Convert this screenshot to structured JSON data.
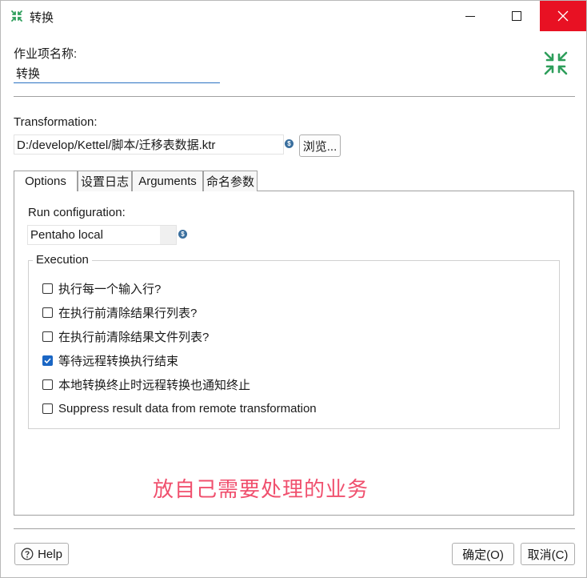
{
  "window": {
    "title": "转换",
    "icon": "transformation-icon",
    "controls": {
      "minimize": "minimize-icon",
      "maximize": "maximize-icon",
      "close": "close-icon"
    }
  },
  "job": {
    "name_label": "作业项名称:",
    "name_value": "转换",
    "badge_icon": "transform-arrows-icon",
    "badge_color": "#2e9e5b"
  },
  "transformation": {
    "label": "Transformation:",
    "path": "D:/develop/Kettel/脚本/迁移表数据.ktr",
    "browse_label": "浏览..."
  },
  "tabs": [
    {
      "label": "Options",
      "active": true
    },
    {
      "label": "设置日志",
      "active": false
    },
    {
      "label": "Arguments",
      "active": false
    },
    {
      "label": "命名参数",
      "active": false
    }
  ],
  "options": {
    "run_config_label": "Run configuration:",
    "run_config_value": "Pentaho local",
    "execution_label": "Execution",
    "checkboxes": [
      {
        "label": "执行每一个输入行?",
        "checked": false
      },
      {
        "label": "在执行前清除结果行列表?",
        "checked": false
      },
      {
        "label": "在执行前清除结果文件列表?",
        "checked": false
      },
      {
        "label": "等待远程转换执行结束",
        "checked": true
      },
      {
        "label": "本地转换终止时远程转换也通知终止",
        "checked": false
      },
      {
        "label": "Suppress result data from remote transformation",
        "checked": false
      }
    ]
  },
  "annotation": {
    "text": "放自己需要处理的业务",
    "color": "#f0506e"
  },
  "footer": {
    "help_label": "Help",
    "ok_label": "确定(O)",
    "cancel_label": "取消(C)"
  },
  "colors": {
    "accent": "#1a66c4",
    "close_button": "#e81123",
    "variable_icon": "#3a6f9e"
  }
}
